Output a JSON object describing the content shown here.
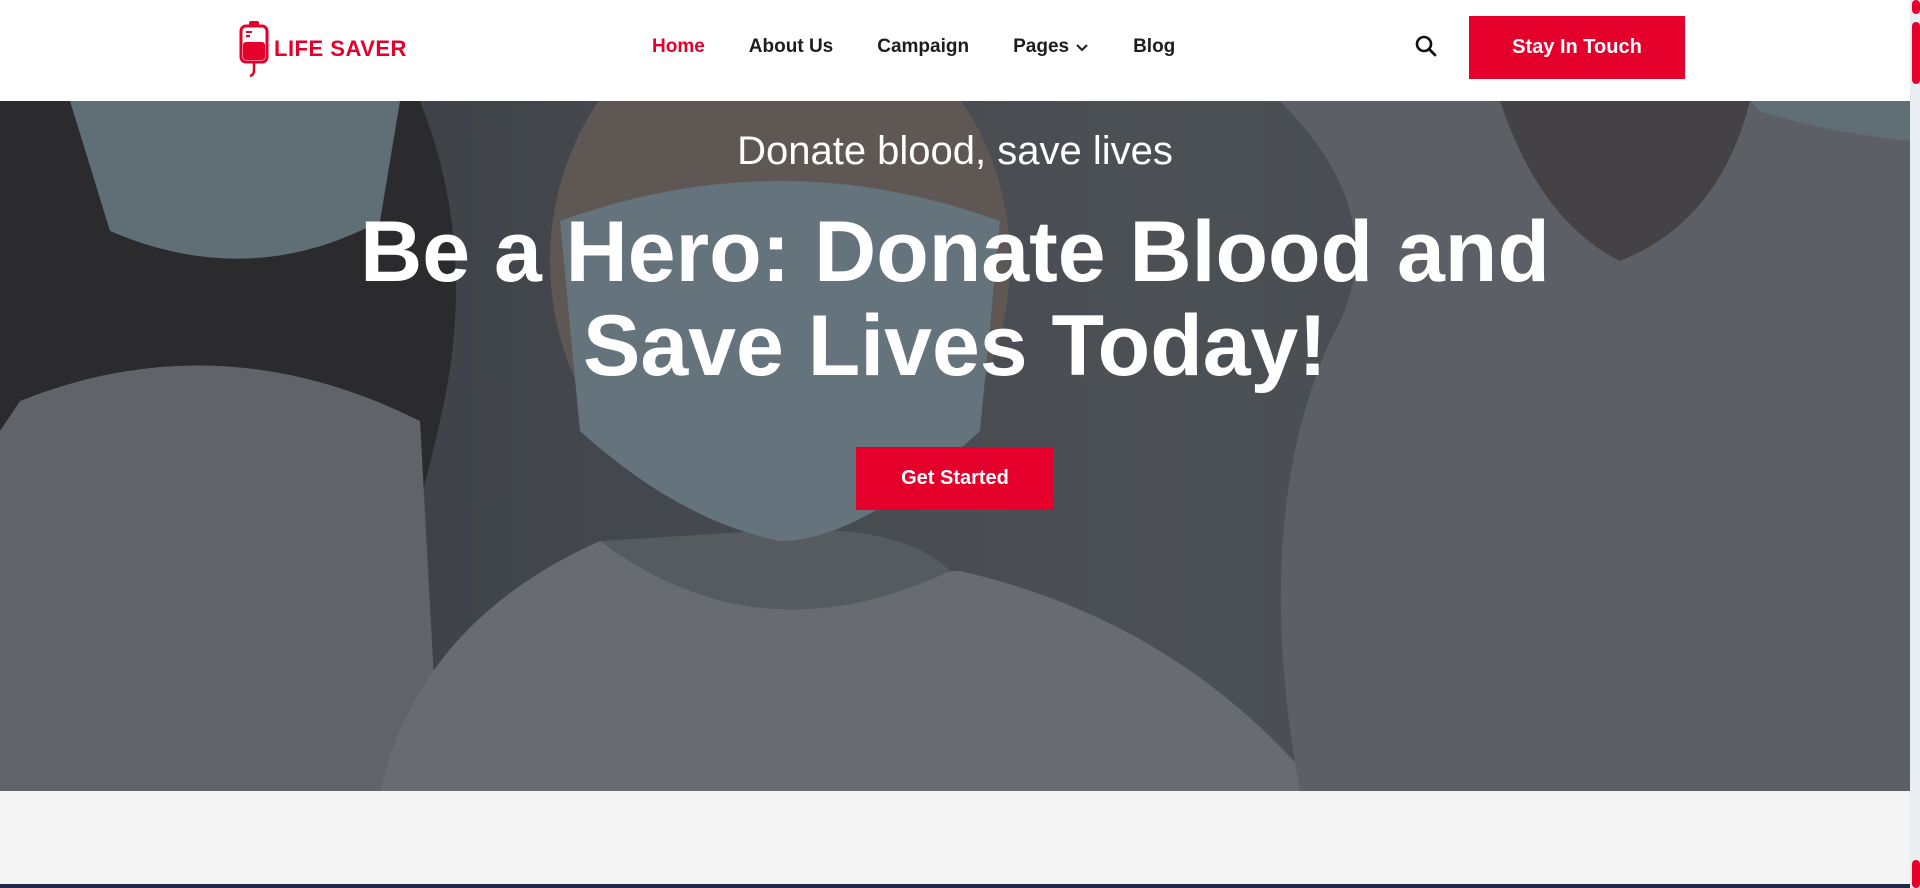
{
  "brand": {
    "name": "LIFE SAVER",
    "accent_color": "#e5002b"
  },
  "nav": {
    "items": [
      {
        "label": "Home",
        "active": true
      },
      {
        "label": "About Us",
        "active": false
      },
      {
        "label": "Campaign",
        "active": false
      },
      {
        "label": "Pages",
        "active": false,
        "dropdown": true
      },
      {
        "label": "Blog",
        "active": false
      }
    ],
    "search_icon": "search-icon",
    "cta_label": "Stay In Touch"
  },
  "hero": {
    "subtitle": "Donate blood, save lives",
    "title": "Be a Hero: Donate Blood and Save Lives Today!",
    "button_label": "Get Started"
  }
}
